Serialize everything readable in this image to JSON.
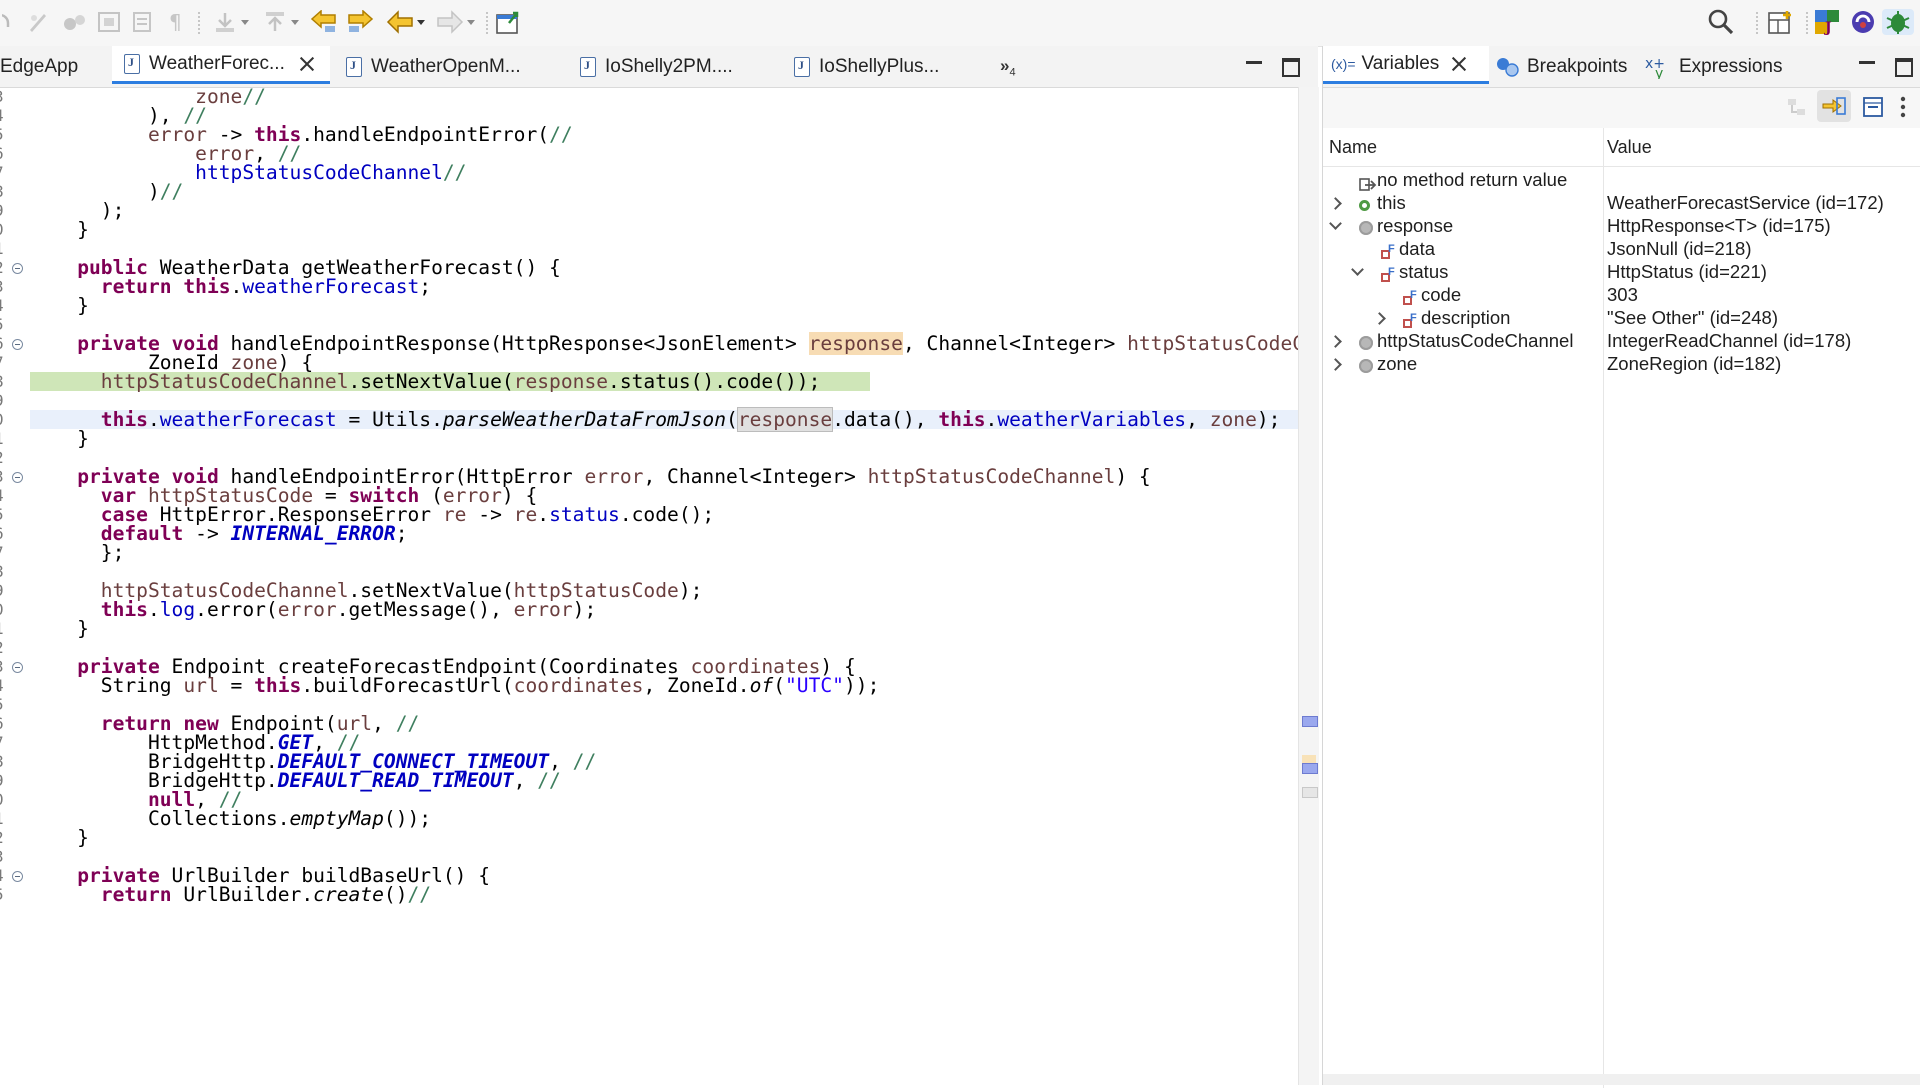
{
  "editor": {
    "tabs": [
      {
        "label": "EdgeApp",
        "active": false
      },
      {
        "label": "WeatherForec...",
        "active": true
      },
      {
        "label": "WeatherOpenM...",
        "active": false
      },
      {
        "label": "IoShelly2PM....",
        "active": false
      },
      {
        "label": "IoShellyPlus...",
        "active": false
      }
    ],
    "overflow_label": "»",
    "overflow_count": "4",
    "lines": [
      {
        "n": "3",
        "html": "          <span class='p'>zone</span><span class='c'>//</span>"
      },
      {
        "n": "4",
        "html": "      ), <span class='c'>//</span>"
      },
      {
        "n": "5",
        "html": "      <span class='p'>error</span> -&gt; <span class='k'>this</span>.handleEndpointError(<span class='c'>//</span>"
      },
      {
        "n": "6",
        "html": "          <span class='p'>error</span>, <span class='c'>//</span>"
      },
      {
        "n": "7",
        "html": "          <span class='f'>httpStatusCodeChannel</span><span class='c'>//</span>"
      },
      {
        "n": "8",
        "html": "      )<span class='c'>//</span>"
      },
      {
        "n": "9",
        "html": "  );"
      },
      {
        "n": "0",
        "html": "}"
      },
      {
        "n": "1",
        "html": ""
      },
      {
        "n": "2",
        "fold": true,
        "html": "<span class='k'>public</span> WeatherData getWeatherForecast() {"
      },
      {
        "n": "3",
        "html": "  <span class='k'>return</span> <span class='k'>this</span>.<span class='f'>weatherForecast</span>;"
      },
      {
        "n": "4",
        "html": "}"
      },
      {
        "n": "5",
        "html": ""
      },
      {
        "n": "6",
        "fold": true,
        "html": "<span class='k'>private</span> <span class='k'>void</span> handleEndpointResponse(HttpResponse&lt;JsonElement&gt; <span class='p hl-occ'>response</span>, Channel&lt;Integer&gt; <span class='p'>httpStatusCodeChannel</span>,"
      },
      {
        "n": "7",
        "html": "      ZoneId <span class='p'>zone</span>) {"
      },
      {
        "n": "8",
        "html": "  <span class='p'>httpStatusCodeChannel</span>.setNextValue(<span class='p'>response</span>.status().code());"
      },
      {
        "n": "9",
        "html": ""
      },
      {
        "n": "0",
        "html": "  <span class='k'>this</span>.<span class='f'>weatherForecast</span> = Utils.<span class='it'>parseWeatherDataFromJson</span>(<span class='p hl-occ2'>response</span>.data(), <span class='k'>this</span>.<span class='f'>weatherVariables</span>, <span class='p'>zone</span>);"
      },
      {
        "n": "1",
        "html": "}"
      },
      {
        "n": "2",
        "html": ""
      },
      {
        "n": "3",
        "fold": true,
        "html": "<span class='k'>private</span> <span class='k'>void</span> handleEndpointError(HttpError <span class='p'>error</span>, Channel&lt;Integer&gt; <span class='p'>httpStatusCodeChannel</span>) {"
      },
      {
        "n": "4",
        "html": "  <span class='k'>var</span> <span class='p'>httpStatusCode</span> = <span class='k'>switch</span> (<span class='p'>error</span>) {"
      },
      {
        "n": "5",
        "html": "  <span class='k'>case</span> HttpError.ResponseError <span class='p'>re</span> -&gt; <span class='p'>re</span>.<span class='f'>status</span>.code();"
      },
      {
        "n": "6",
        "html": "  <span class='k'>default</span> -&gt; <span class='cn'>INTERNAL_ERROR</span>;"
      },
      {
        "n": "7",
        "html": "  };"
      },
      {
        "n": "8",
        "html": ""
      },
      {
        "n": "9",
        "html": "  <span class='p'>httpStatusCodeChannel</span>.setNextValue(<span class='p'>httpStatusCode</span>);"
      },
      {
        "n": "0",
        "html": "  <span class='k'>this</span>.<span class='f'>log</span>.error(<span class='p'>error</span>.getMessage(), <span class='p'>error</span>);"
      },
      {
        "n": "1",
        "html": "}"
      },
      {
        "n": "2",
        "html": ""
      },
      {
        "n": "3",
        "fold": true,
        "html": "<span class='k'>private</span> Endpoint createForecastEndpoint(Coordinates <span class='p'>coordinates</span>) {"
      },
      {
        "n": "4",
        "html": "  String <span class='p'>url</span> = <span class='k'>this</span>.buildForecastUrl(<span class='p'>coordinates</span>, ZoneId.<span class='it'>of</span>(<span class='s'>\"UTC\"</span>));"
      },
      {
        "n": "5",
        "html": ""
      },
      {
        "n": "6",
        "html": "  <span class='k'>return</span> <span class='k'>new</span> Endpoint(<span class='p'>url</span>, <span class='c'>//</span>"
      },
      {
        "n": "7",
        "html": "      HttpMethod.<span class='cn'>GET</span>, <span class='c'>//</span>"
      },
      {
        "n": "8",
        "html": "      BridgeHttp.<span class='cn'>DEFAULT_CONNECT_TIMEOUT</span>, <span class='c'>//</span>"
      },
      {
        "n": "9",
        "html": "      BridgeHttp.<span class='cn'>DEFAULT_READ_TIMEOUT</span>, <span class='c'>//</span>"
      },
      {
        "n": "0",
        "html": "      <span class='k'>null</span>, <span class='c'>//</span>"
      },
      {
        "n": "1",
        "html": "      Collections.<span class='it'>emptyMap</span>());"
      },
      {
        "n": "2",
        "html": "}"
      },
      {
        "n": "3",
        "html": ""
      },
      {
        "n": "4",
        "fold": true,
        "html": "<span class='k'>private</span> UrlBuilder buildBaseUrl() {"
      },
      {
        "n": "5",
        "html": "  <span class='k'>return</span> UrlBuilder.<span class='it'>create</span>()<span class='c'>//</span>"
      }
    ]
  },
  "variables_view": {
    "tabs": [
      {
        "label": "Variables",
        "prefix": "(x)=",
        "active": true
      },
      {
        "label": "Breakpoints",
        "active": false
      },
      {
        "label": "Expressions",
        "active": false
      }
    ],
    "columns": {
      "name": "Name",
      "value": "Value"
    },
    "rows": [
      {
        "name": "no method return value",
        "value": "",
        "icon": "return-icon",
        "indent": 0,
        "expander": "none"
      },
      {
        "name": "this",
        "value": "WeatherForecastService  (id=172)",
        "icon": "public-icon",
        "indent": 0,
        "expander": "collapsed"
      },
      {
        "name": "response",
        "value": "HttpResponse<T>  (id=175)",
        "icon": "local-icon",
        "indent": 0,
        "expander": "expanded"
      },
      {
        "name": "data",
        "value": "JsonNull  (id=218)",
        "icon": "field-icon",
        "indent": 1,
        "expander": "none"
      },
      {
        "name": "status",
        "value": "HttpStatus  (id=221)",
        "icon": "field-icon",
        "indent": 1,
        "expander": "expanded"
      },
      {
        "name": "code",
        "value": "303",
        "icon": "field-icon",
        "indent": 2,
        "expander": "none"
      },
      {
        "name": "description",
        "value": "\"See Other\" (id=248)",
        "icon": "field-icon",
        "indent": 2,
        "expander": "collapsed"
      },
      {
        "name": "httpStatusCodeChannel",
        "value": "IntegerReadChannel  (id=178)",
        "icon": "local-icon",
        "indent": 0,
        "expander": "collapsed"
      },
      {
        "name": "zone",
        "value": "ZoneRegion  (id=182)",
        "icon": "local-icon",
        "indent": 0,
        "expander": "collapsed"
      }
    ]
  },
  "colors": {
    "accent": "#2c7de0",
    "current_line": "#cfe6b8",
    "keyword": "#7f0055",
    "field": "#0000c0",
    "comment": "#3f7f5f"
  }
}
